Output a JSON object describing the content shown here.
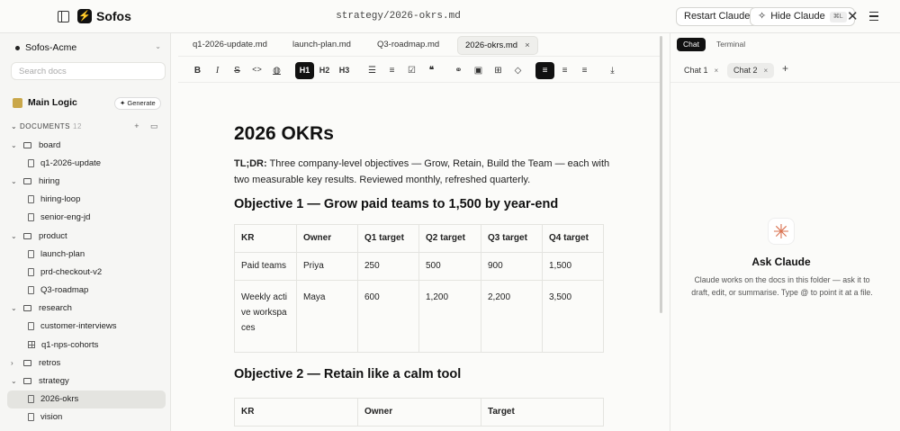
{
  "app": {
    "name": "Sofos",
    "file_path": "strategy/2026-okrs.md"
  },
  "topbar": {
    "restart_label": "Restart Claude",
    "hide_label": "Hide Claude",
    "hide_shortcut": "⌘L"
  },
  "sidebar": {
    "workspace": "Sofos-Acme",
    "search_placeholder": "Search docs",
    "main_logic": "Main Logic",
    "generate_label": "✦ Generate",
    "documents_label": "DOCUMENTS",
    "documents_count": "12",
    "tree": [
      {
        "type": "folder",
        "label": "board",
        "expanded": true
      },
      {
        "type": "file",
        "label": "q1-2026-update"
      },
      {
        "type": "folder",
        "label": "hiring",
        "expanded": true
      },
      {
        "type": "file",
        "label": "hiring-loop"
      },
      {
        "type": "file",
        "label": "senior-eng-jd"
      },
      {
        "type": "folder",
        "label": "product",
        "expanded": true
      },
      {
        "type": "file",
        "label": "launch-plan"
      },
      {
        "type": "file",
        "label": "prd-checkout-v2"
      },
      {
        "type": "file",
        "label": "Q3-roadmap"
      },
      {
        "type": "folder",
        "label": "research",
        "expanded": true
      },
      {
        "type": "file",
        "label": "customer-interviews"
      },
      {
        "type": "table",
        "label": "q1-nps-cohorts"
      },
      {
        "type": "folder",
        "label": "retros",
        "expanded": false
      },
      {
        "type": "folder",
        "label": "strategy",
        "expanded": true
      },
      {
        "type": "file",
        "label": "2026-okrs",
        "selected": true
      },
      {
        "type": "file",
        "label": "vision"
      }
    ]
  },
  "editor": {
    "tabs": [
      "q1-2026-update.md",
      "launch-plan.md",
      "Q3-roadmap.md",
      "2026-okrs.md"
    ],
    "active_tab": "2026-okrs.md",
    "toolbar": [
      "B",
      "I",
      "S",
      "<>",
      "H1",
      "H2",
      "H3"
    ],
    "doc": {
      "title": "2026 OKRs",
      "tldr_label": "TL;DR:",
      "tldr_text": " Three company-level objectives — Grow, Retain, Build the Team — each with two measurable key results. Reviewed monthly, refreshed quarterly.",
      "objective1": "Objective 1 — Grow paid teams to 1,500 by year-end",
      "table1": {
        "headers": [
          "KR",
          "Owner",
          "Q1 target",
          "Q2 target",
          "Q3 target",
          "Q4 target"
        ],
        "rows": [
          [
            "Paid teams",
            "Priya",
            "250",
            "500",
            "900",
            "1,500"
          ],
          [
            "Weekly active workspaces",
            "Maya",
            "600",
            "1,200",
            "2,200",
            "3,500"
          ]
        ]
      },
      "objective2": "Objective 2 — Retain like a calm tool",
      "table2": {
        "headers": [
          "KR",
          "Owner",
          "Target"
        ]
      }
    }
  },
  "panel": {
    "tabs": [
      "Chat",
      "Terminal"
    ],
    "chats": [
      "Chat 1",
      "Chat 2"
    ],
    "ask_title": "Ask Claude",
    "ask_desc": "Claude works on the docs in this folder — ask it to draft, edit, or summarise. Type @ to point it at a file."
  }
}
